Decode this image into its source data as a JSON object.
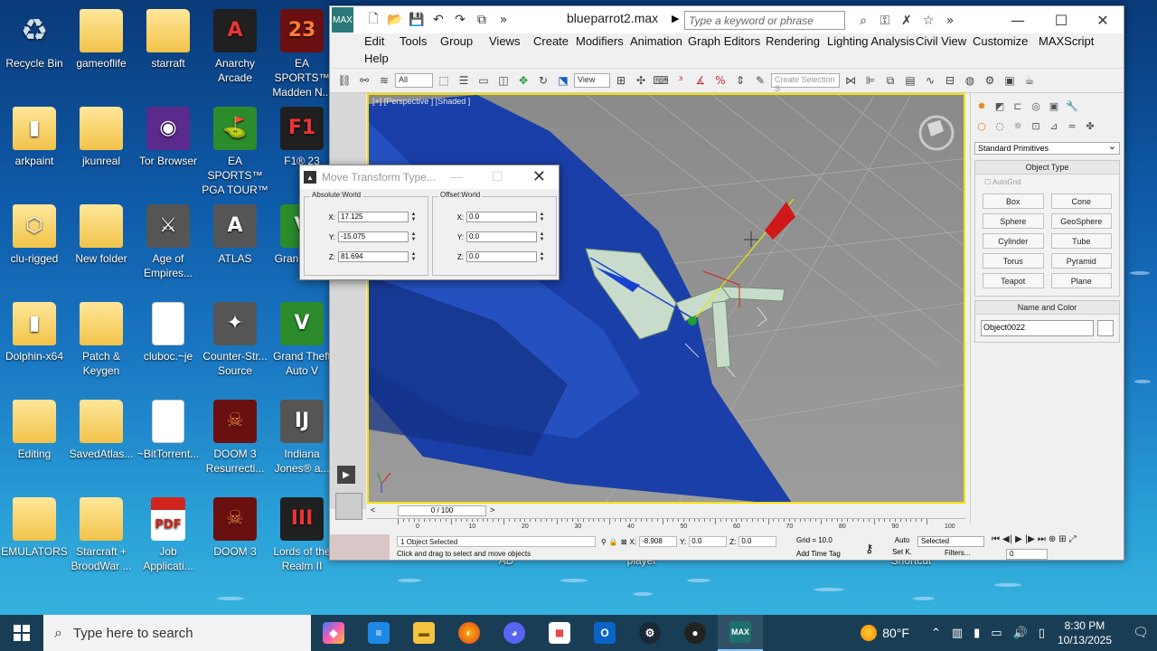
{
  "desktop": {
    "icons": [
      {
        "label": "Recycle Bin",
        "glyph": "♻",
        "kind": "recycle"
      },
      {
        "label": "gameoflife",
        "glyph": "",
        "kind": "folder"
      },
      {
        "label": "starraft",
        "glyph": "",
        "kind": "folder"
      },
      {
        "label": "Anarchy Arcade",
        "glyph": "A",
        "kind": "app-dark"
      },
      {
        "label": "EA SPORTS™ Madden N...",
        "glyph": "23",
        "kind": "app-red"
      },
      {
        "label": "arkpaint",
        "glyph": "▮",
        "kind": "folder"
      },
      {
        "label": "jkunreal",
        "glyph": "",
        "kind": "folder"
      },
      {
        "label": "Tor Browser",
        "glyph": "◉",
        "kind": "app-purple"
      },
      {
        "label": "EA SPORTS™ PGA TOUR™",
        "glyph": "⛳",
        "kind": "app-green"
      },
      {
        "label": "F1® 23",
        "glyph": "F1",
        "kind": "app-dark"
      },
      {
        "label": "clu-rigged",
        "glyph": "⬡",
        "kind": "folder"
      },
      {
        "label": "New folder",
        "glyph": "",
        "kind": "folder"
      },
      {
        "label": "Age of Empires...",
        "glyph": "⚔",
        "kind": "app-gray"
      },
      {
        "label": "ATLAS",
        "glyph": "A",
        "kind": "app-gray"
      },
      {
        "label": "Grand Auto",
        "glyph": "V",
        "kind": "app-green"
      },
      {
        "label": "Dolphin-x64",
        "glyph": "▮",
        "kind": "folder"
      },
      {
        "label": "Patch & Keygen",
        "glyph": "",
        "kind": "folder"
      },
      {
        "label": "cluboc.~je",
        "glyph": "",
        "kind": "file"
      },
      {
        "label": "Counter-Str... Source",
        "glyph": "✦",
        "kind": "app-gray"
      },
      {
        "label": "Grand Theft Auto V",
        "glyph": "V",
        "kind": "app-green"
      },
      {
        "label": "Editing",
        "glyph": "",
        "kind": "folder"
      },
      {
        "label": "SavedAtlas...",
        "glyph": "",
        "kind": "folder"
      },
      {
        "label": "~BitTorrent...",
        "glyph": "",
        "kind": "file"
      },
      {
        "label": "DOOM 3 Resurrecti...",
        "glyph": "☠",
        "kind": "app-red"
      },
      {
        "label": "Indiana Jones® a...",
        "glyph": "IJ",
        "kind": "app-gray"
      },
      {
        "label": "EMULATORS",
        "glyph": "",
        "kind": "folder"
      },
      {
        "label": "Starcraft + BroodWar ...",
        "glyph": "",
        "kind": "folder"
      },
      {
        "label": "Job Applicati...",
        "glyph": "PDF",
        "kind": "pdf"
      },
      {
        "label": "DOOM 3",
        "glyph": "☠",
        "kind": "app-red"
      },
      {
        "label": "Lords of the Realm II",
        "glyph": "III",
        "kind": "app-dark"
      }
    ],
    "hidden_labels": [
      "AD",
      "player",
      "Shortcut"
    ]
  },
  "max": {
    "document_title": "blueparrot2.max",
    "search_placeholder": "Type a keyword or phrase",
    "window_controls": {
      "minimize": "—",
      "maximize": "☐",
      "close": "✕"
    },
    "menu": [
      "Edit",
      "Tools",
      "Group",
      "Views",
      "Create",
      "Modifiers",
      "Animation",
      "Graph Editors",
      "Rendering",
      "Lighting Analysis",
      "Civil View",
      "Customize",
      "MAXScript",
      "Help"
    ],
    "toolbar": {
      "filter_value": "All",
      "view_value": "View",
      "selection_set_placeholder": "Create Selection S"
    },
    "viewport_label": "[+] [Perspective ] [Shaded ]",
    "command_panel": {
      "category": "Standard Primitives",
      "object_type_title": "Object Type",
      "autogrid_label": "AutoGrid",
      "primitives": [
        "Box",
        "Cone",
        "Sphere",
        "GeoSphere",
        "Cylinder",
        "Tube",
        "Torus",
        "Pyramid",
        "Teapot",
        "Plane"
      ],
      "name_color_title": "Name and Color",
      "object_name": "Object0022"
    },
    "time_slider": "0 / 100",
    "timeline_ticks": [
      "0",
      "10",
      "20",
      "30",
      "40",
      "50",
      "60",
      "70",
      "80",
      "90",
      "100"
    ],
    "status": {
      "selection": "1 Object Selected",
      "prompt": "Click and drag to select and move objects",
      "x": "-8.908",
      "y": "0.0",
      "z": "0.0",
      "grid": "Grid = 10.0",
      "add_time_tag": "Add Time Tag",
      "auto_key": "Auto",
      "set_key": "Set K.",
      "selected_dd": "Selected",
      "filters": "Filters...",
      "frame": "0"
    }
  },
  "dialog": {
    "title": "Move Transform Type...",
    "absolute_title": "Absolute:World",
    "offset_title": "Offset:World",
    "absolute": {
      "x": "17.125",
      "y": "-15.075",
      "z": "81.694"
    },
    "offset": {
      "x": "0.0",
      "y": "0.0",
      "z": "0.0"
    },
    "axis_labels": {
      "x": "X:",
      "y": "Y:",
      "z": "Z:"
    }
  },
  "taskbar": {
    "search_placeholder": "Type here to search",
    "temperature": "80°F",
    "time": "8:30 PM",
    "date": "10/13/2025"
  }
}
